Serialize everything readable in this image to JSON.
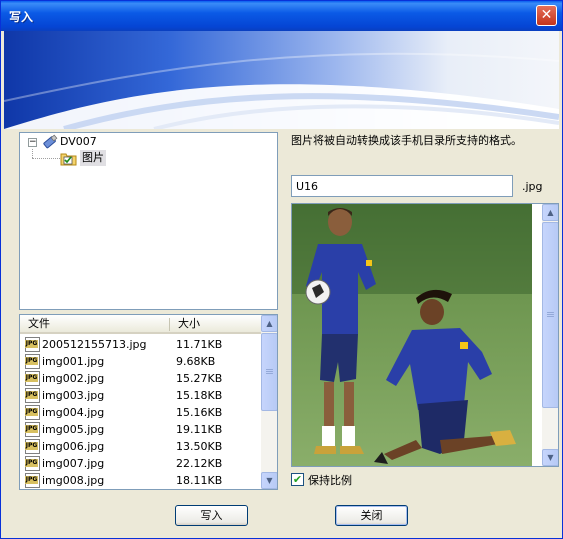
{
  "window": {
    "title": "写入",
    "close_symbol": "✕"
  },
  "tree": {
    "root": {
      "label": "DV007",
      "expander": "−",
      "icon": "usb-drive-icon"
    },
    "child": {
      "label": "图片",
      "icon": "checked-folder-icon"
    }
  },
  "file_list": {
    "columns": [
      "文件",
      "大小"
    ],
    "files": [
      {
        "name": "200512155713.jpg",
        "size": "11.71KB"
      },
      {
        "name": "img001.jpg",
        "size": "9.68KB"
      },
      {
        "name": "img002.jpg",
        "size": "15.27KB"
      },
      {
        "name": "img003.jpg",
        "size": "15.18KB"
      },
      {
        "name": "img004.jpg",
        "size": "15.16KB"
      },
      {
        "name": "img005.jpg",
        "size": "19.11KB"
      },
      {
        "name": "img006.jpg",
        "size": "13.50KB"
      },
      {
        "name": "img007.jpg",
        "size": "22.12KB"
      },
      {
        "name": "img008.jpg",
        "size": "18.11KB"
      }
    ],
    "file_icon_label": "JPG"
  },
  "info_text": "图片将被自动转换成该手机目录所支持的格式。",
  "filename_input": {
    "value": "U16"
  },
  "extension": ".jpg",
  "keep_ratio": {
    "label": "保持比例",
    "checked": true,
    "check_symbol": "✔"
  },
  "buttons": {
    "write": "写入",
    "close": "关闭"
  },
  "scroll": {
    "up": "▲",
    "down": "▼",
    "grip": "≡"
  },
  "colors": {
    "title_bar": "#0A5FEF",
    "dialog_bg": "#ECE9D8",
    "close_button": "#D44A2E",
    "player_jersey": "#2A3FA8"
  }
}
